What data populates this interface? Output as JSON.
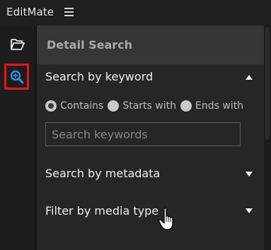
{
  "app": {
    "title": "EditMate"
  },
  "panel": {
    "title": "Detail Search"
  },
  "keyword_section": {
    "title": "Search by keyword",
    "expanded": true,
    "match_options": [
      "Contains",
      "Starts with",
      "Ends with"
    ],
    "selected_option": "Contains",
    "search": {
      "placeholder": "Search keywords",
      "value": ""
    }
  },
  "metadata_section": {
    "title": "Search by metadata",
    "expanded": false
  },
  "media_section": {
    "title": "Filter by media type",
    "expanded": false
  },
  "sidebar": {
    "items": [
      {
        "name": "folder",
        "icon": "folder-open-icon",
        "active": false
      },
      {
        "name": "search",
        "icon": "zoom-in-icon",
        "active": true
      }
    ]
  },
  "colors": {
    "accent": "#3a8ee6",
    "highlight_border": "#e8141b",
    "panel_header": "#363636",
    "panel_bg": "#262626"
  }
}
